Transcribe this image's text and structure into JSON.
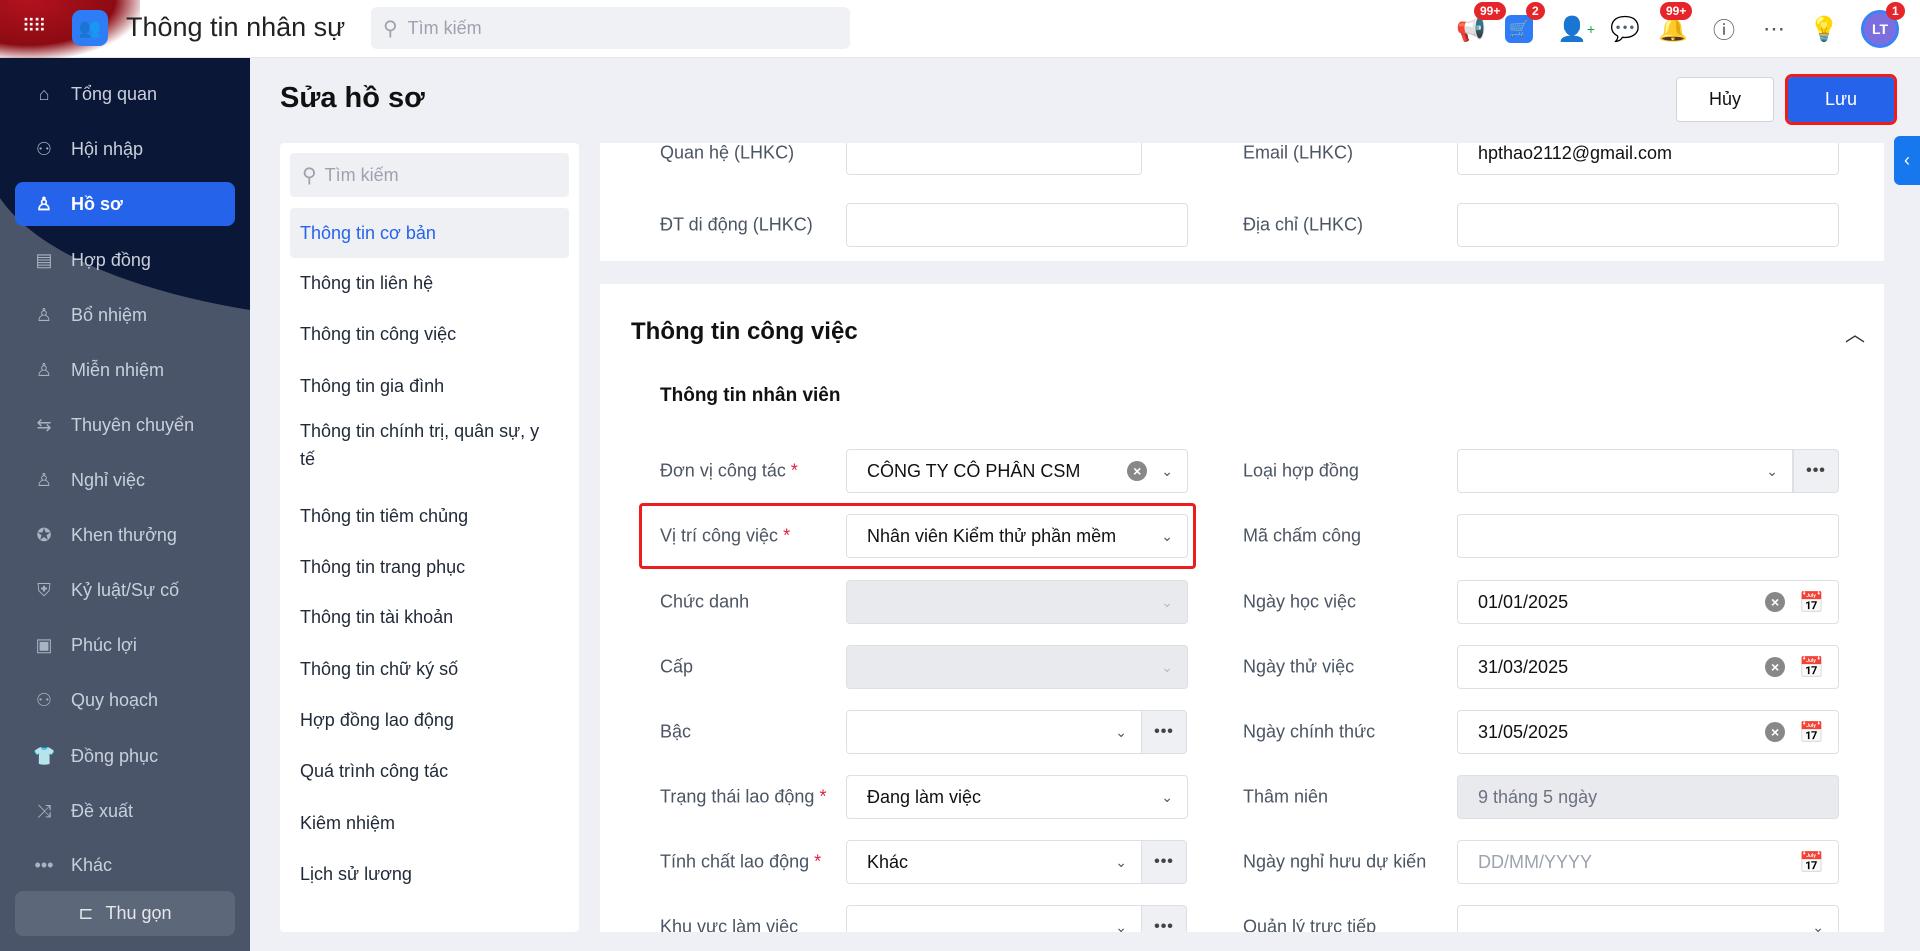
{
  "header": {
    "app_title": "Thông tin nhân sự",
    "search_placeholder": "Tìm kiếm",
    "badges": {
      "announcements": "99+",
      "cart": "2",
      "notifications": "99+",
      "avatar": "1"
    },
    "avatar_initials": "LT"
  },
  "sidebar": {
    "items": [
      {
        "label": "Tổng quan",
        "icon": "⌂"
      },
      {
        "label": "Hội nhập",
        "icon": "⚇"
      },
      {
        "label": "Hồ sơ",
        "icon": "♙",
        "active": true
      },
      {
        "label": "Hợp đồng",
        "icon": "▤"
      },
      {
        "label": "Bổ nhiệm",
        "icon": "♙"
      },
      {
        "label": "Miễn nhiệm",
        "icon": "♙"
      },
      {
        "label": "Thuyên chuyển",
        "icon": "⇆"
      },
      {
        "label": "Nghỉ việc",
        "icon": "♙"
      },
      {
        "label": "Khen thưởng",
        "icon": "✪"
      },
      {
        "label": "Kỷ luật/Sự cố",
        "icon": "⛨"
      },
      {
        "label": "Phúc lợi",
        "icon": "▣"
      },
      {
        "label": "Quy hoạch",
        "icon": "⚇"
      },
      {
        "label": "Đồng phục",
        "icon": "👕"
      },
      {
        "label": "Đề xuất",
        "icon": "⤨"
      },
      {
        "label": "Khác",
        "icon": "•••"
      }
    ],
    "collapse_label": "Thu gọn"
  },
  "page": {
    "title": "Sửa hồ sơ",
    "cancel_label": "Hủy",
    "save_label": "Lưu"
  },
  "nav": {
    "search_placeholder": "Tìm kiếm",
    "items": [
      "Thông tin cơ bản",
      "Thông tin liên hệ",
      "Thông tin công việc",
      "Thông tin gia đình",
      "Thông tin chính trị, quân sự, y tế",
      "Thông tin tiêm chủng",
      "Thông tin trang phục",
      "Thông tin tài khoản",
      "Thông tin chữ ký số",
      "Hợp đồng lao động",
      "Quá trình công tác",
      "Kiêm nhiệm",
      "Lịch sử lương"
    ]
  },
  "contact": {
    "relation_label": "Quan hệ (LHKC)",
    "email_label": "Email (LHKC)",
    "email_value": "hpthao2112@gmail.com",
    "phone_label": "ĐT di động (LHKC)",
    "address_label": "Địa chỉ (LHKC)"
  },
  "job": {
    "section_title": "Thông tin công việc",
    "subsection_title": "Thông tin nhân viên",
    "left": [
      {
        "label": "Đơn vị công tác",
        "required": "*",
        "value": "CÔNG TY CÔ PHÂN CSM"
      },
      {
        "label": "Vị trí công việc",
        "required": "*",
        "value": "Nhân viên Kiểm thử phần mềm"
      },
      {
        "label": "Chức danh",
        "value": ""
      },
      {
        "label": "Cấp",
        "value": ""
      },
      {
        "label": "Bậc",
        "value": ""
      },
      {
        "label": "Trạng thái lao động",
        "required": "*",
        "value": "Đang làm việc"
      },
      {
        "label": "Tính chất lao động",
        "required": "*",
        "value": "Khác"
      },
      {
        "label": "Khu vực làm việc",
        "value": ""
      }
    ],
    "right": [
      {
        "label": "Loại hợp đồng",
        "value": ""
      },
      {
        "label": "Mã chấm công",
        "value": ""
      },
      {
        "label": "Ngày học việc",
        "value": "01/01/2025"
      },
      {
        "label": "Ngày thử việc",
        "value": "31/03/2025"
      },
      {
        "label": "Ngày chính thức",
        "value": "31/05/2025"
      },
      {
        "label": "Thâm niên",
        "value": "9 tháng 5 ngày"
      },
      {
        "label": "Ngày nghỉ hưu dự kiến",
        "placeholder": "DD/MM/YYYY"
      },
      {
        "label": "Quản lý trực tiếp",
        "value": ""
      }
    ]
  }
}
